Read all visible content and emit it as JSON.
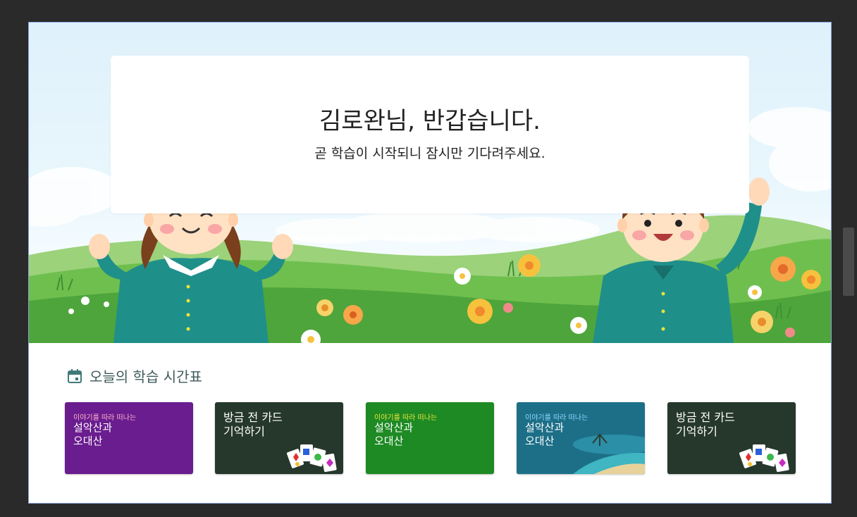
{
  "welcome": {
    "title": "김로완님, 반갑습니다.",
    "subtitle": "곧 학습이 시작되니 잠시만 기다려주세요."
  },
  "schedule": {
    "header": "오늘의 학습 시간표",
    "cards": [
      {
        "small": "이야기를 따라 떠나는",
        "main": "설악산과\n오대산",
        "bg": "#6a1d8f",
        "small_color": "#ffb3c8"
      },
      {
        "small": "",
        "main": "방금 전 카드\n기억하기",
        "bg": "#26382c"
      },
      {
        "small": "이야기를 따라 떠나는",
        "main": "설악산과\n오대산",
        "bg": "#1e8a24",
        "small_color": "#e8e43a"
      },
      {
        "small": "이야기를 따라 떠나는",
        "main": "설악산과\n오대산",
        "bg": "#1d6f88",
        "small_color": "#8fd6ff"
      },
      {
        "small": "",
        "main": "방금 전 카드\n기억하기",
        "bg": "#26382c"
      }
    ]
  },
  "colors": {
    "uniform": "#1f8f8a",
    "frame_border": "#8aa0d8",
    "header_text": "#3f5a5a"
  }
}
